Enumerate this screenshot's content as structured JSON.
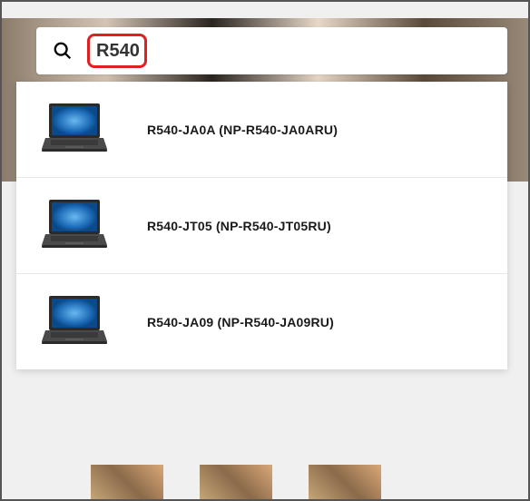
{
  "search": {
    "query": "R540"
  },
  "results": [
    {
      "prefix": "R540",
      "suffix": "-JA0A (NP-R540-JA0ARU)"
    },
    {
      "prefix": "R540",
      "suffix": "-JT05 (NP-R540-JT05RU)"
    },
    {
      "prefix": "R540",
      "suffix": "-JA09 (NP-R540-JA09RU)"
    }
  ]
}
